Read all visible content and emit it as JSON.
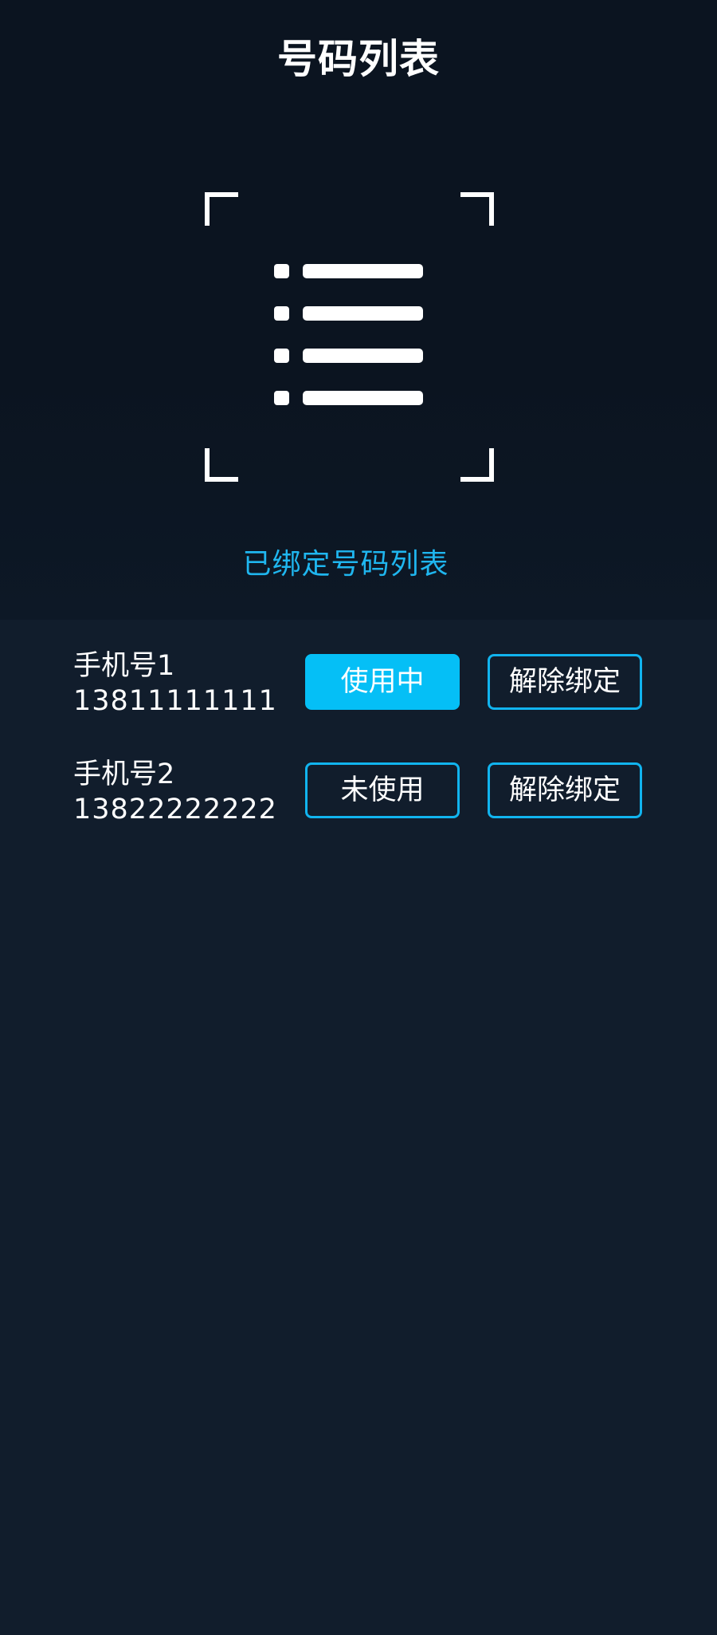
{
  "header": {
    "title": "号码列表",
    "illustration_icon": "list-scan-icon",
    "subtitle": "已绑定号码列表"
  },
  "colors": {
    "top_background": "#0b1420",
    "list_background": "#111d2c",
    "accent": "#05bff6",
    "subtitle": "#1fb6ef"
  },
  "numbers": [
    {
      "label": "手机号1",
      "value": "13811111111",
      "status_label": "使用中",
      "status_active": true,
      "unbind_label": "解除绑定"
    },
    {
      "label": "手机号2",
      "value": "13822222222",
      "status_label": "未使用",
      "status_active": false,
      "unbind_label": "解除绑定"
    }
  ]
}
